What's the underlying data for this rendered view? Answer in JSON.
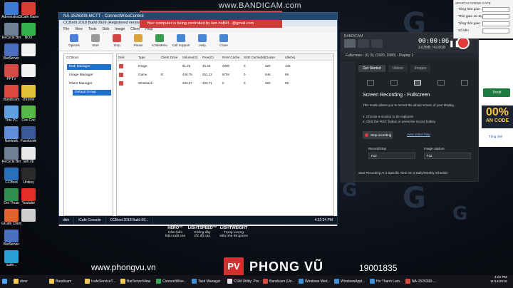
{
  "watermark": "www.BANDICAM.com",
  "desktop": {
    "icons_left": [
      {
        "label": "Administra...",
        "color": "#3c7bd1"
      },
      {
        "label": "Recycle Bin",
        "color": "#6f7f96"
      },
      {
        "label": "BarServer",
        "color": "#4a6fbf"
      },
      {
        "label": "PPTV",
        "color": "#d44b45"
      },
      {
        "label": "Bandicam",
        "color": "#d94a3b"
      },
      {
        "label": "This PC",
        "color": "#5ea0e0"
      },
      {
        "label": "Network",
        "color": "#5e8fd8"
      },
      {
        "label": "Recycle Bin",
        "color": "#6f7f96"
      },
      {
        "label": "CCBoot",
        "color": "#2a6fba"
      },
      {
        "label": "Doi Thoai",
        "color": "#2f8f4e"
      },
      {
        "label": "GCafe Client",
        "color": "#e3622d"
      },
      {
        "label": "BarServer",
        "color": "#4a6fbf"
      },
      {
        "label": "icafe...",
        "color": "#2a9fd6"
      }
    ],
    "icons_right": [
      {
        "label": "GCafe Games",
        "color": "#d93c32"
      },
      {
        "label": "NOX",
        "color": "#33b04a"
      },
      {
        "label": "",
        "color": "#f2f2f2"
      },
      {
        "label": "",
        "color": "#f2f2f2"
      },
      {
        "label": "chrome",
        "color": "#e2c13b"
      },
      {
        "label": "Coc Coc",
        "color": "#57b84a"
      },
      {
        "label": "Facebook",
        "color": "#3b5998"
      },
      {
        "label": "lam.vb",
        "color": "#e8e8e8"
      },
      {
        "label": "Unikey",
        "color": "#2a2a2a"
      },
      {
        "label": "Youtube",
        "color": "#e52d27"
      },
      {
        "label": "",
        "color": "#cfcfcf"
      }
    ]
  },
  "remote": {
    "banner": "Your computer is being controlled by lam.hoB4f...@gmail.com"
  },
  "ccboot": {
    "title": "NA-1526308-MCTT - ConnectWiseControl",
    "subtitle": "CCBoot 2018 Build 0926 (Registered version)",
    "menu": [
      "File",
      "View",
      "Tools",
      "Disk",
      "Image",
      "Client",
      "Help"
    ],
    "tools": [
      {
        "label": "Options",
        "color": "#4c7fd6"
      },
      {
        "label": "Start",
        "color": "#999999"
      },
      {
        "label": "Stop",
        "color": "#d64545"
      },
      {
        "label": "Pause",
        "color": "#d9a43b"
      },
      {
        "label": "iCafeMenu",
        "color": "#3c9b51"
      },
      {
        "label": "Call Support",
        "color": "#4a86d4"
      },
      {
        "label": "Help",
        "color": "#4a86d4"
      },
      {
        "label": "Close",
        "color": "#4a86d4"
      }
    ],
    "tree": [
      {
        "label": "CCBoot",
        "selected": false
      },
      {
        "label": "Disk Manager",
        "selected": true
      },
      {
        "label": "Image Manager",
        "selected": false
      },
      {
        "label": "Client Manager",
        "selected": false
      },
      {
        "label": "Default Group",
        "selected": true
      }
    ],
    "columns": [
      "Disk",
      "Type",
      "Client Drive",
      "Volume(G)",
      "Free(G)",
      "RAM Cache...",
      "SSD Cache(M)",
      "Cluster",
      "Idle(%)"
    ],
    "rows": [
      [
        "",
        "Image",
        "",
        "91.26",
        "46.40",
        "2000",
        "0",
        "32K",
        "100"
      ],
      [
        "",
        "Game",
        "E:",
        "446.76",
        "251.12",
        "8704",
        "0",
        "64K",
        "99"
      ],
      [
        "",
        "Writeback",
        "",
        "223.57",
        "193.71",
        "0",
        "0",
        "32K",
        "99"
      ]
    ],
    "row_colors": [
      "#d64545",
      "#d64545",
      "#d64545"
    ],
    "status": "System D: Total 180.49 GB   RAM Total 32G   Ram cache 8/4G   Server Ready  OS Version 6.2.9200.0   RAM 96%",
    "inner_taskbar": [
      "dkin",
      "iCafe Console",
      "CCBoot 2018 Build 09...",
      "4:22:24 PM"
    ]
  },
  "bandicam": {
    "brand": "BANDICAM",
    "time": "00:00:06",
    "size": "3.62MB / 43.6GB",
    "target": "Fullscreen - (0, 0), (1920, 1080) - Display 1",
    "tabs": [
      "Get Started",
      "Videos",
      "Images"
    ],
    "title": "Screen Recording - Fullscreen",
    "desc": "This mode allows you to record the whole screen of your display.",
    "steps": [
      "1. Choose a monitor to be captured.",
      "2. Click the 'REC' button or press the record hotkey."
    ],
    "stop_label": "Stop recording",
    "help_link": "View online help",
    "hk1_label": "Record/Stop",
    "hk1_value": "F12",
    "hk2_label": "Image capture",
    "hk2_value": "F11",
    "footer": "Start Recording At a Specific Time On a Daily/Weekly schedule"
  },
  "timer_widget": {
    "title": "SPARTACY.RESE.CAFE",
    "rows": [
      {
        "label": "Tổng thời gian",
        "value": ""
      },
      {
        "label": "Thời gian sử dụng",
        "value": ""
      },
      {
        "label": "Tổng thời gian",
        "value": ""
      },
      {
        "label": "Số tiền",
        "value": ""
      }
    ]
  },
  "promo": {
    "button": "Thoát",
    "big": "00%",
    "code": "AN CODE",
    "link": "Tổng nhé"
  },
  "hero": [
    {
      "title": "HERO™",
      "line1": "Cảm biến",
      "line2": "hiệu suất cao"
    },
    {
      "title": "LIGHTSPEED™",
      "line1": "Không dây",
      "line2": "tốc độ cao"
    },
    {
      "title": "LIGHTWEIGHT",
      "line1": "Trọng Lượng",
      "line2": "siêu nhẹ 99 grams"
    }
  ],
  "footer_brand": {
    "url": "www.phongvu.vn",
    "logo": "PV",
    "name": "PHONG VŨ",
    "phone": "19001835"
  },
  "taskbar": [
    {
      "label": "diver",
      "color": "#f2c94c"
    },
    {
      "label": "Bandicam",
      "color": "#f2c94c"
    },
    {
      "label": "IcafeServiceT...",
      "color": "#f2c94c"
    },
    {
      "label": "BarServerView",
      "color": "#f2c94c"
    },
    {
      "label": "ConnectWise...",
      "color": "#3aa55d"
    },
    {
      "label": "Task Manager",
      "color": "#3a8fd6"
    },
    {
      "label": "CSM Utility: Pro...",
      "color": "#e0e0e0"
    },
    {
      "label": "Bandicam (Un...",
      "color": "#d94a3b"
    },
    {
      "label": "Windows Med...",
      "color": "#3a8fd6"
    },
    {
      "label": "WindowsAppl...",
      "color": "#3a8fd6"
    },
    {
      "label": "Ho Thanh Lam...",
      "color": "#3a8fd6"
    },
    {
      "label": "NA-1526308-...",
      "color": "#d94a3b"
    }
  ],
  "tray_time": "4:22 PM",
  "tray_date": "11/14/2018"
}
